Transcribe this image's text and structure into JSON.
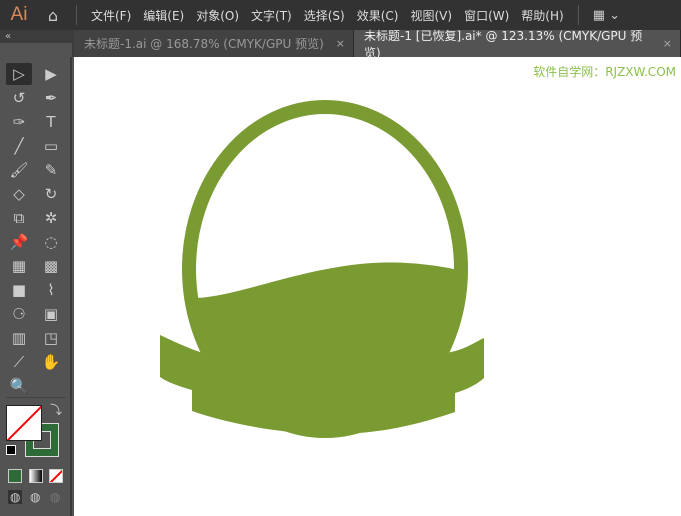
{
  "app": {
    "logo": "Ai",
    "home_icon": "home-icon"
  },
  "menu": [
    "文件(F)",
    "编辑(E)",
    "对象(O)",
    "文字(T)",
    "选择(S)",
    "效果(C)",
    "视图(V)",
    "窗口(W)",
    "帮助(H)"
  ],
  "workspace_icon": "workspace-layout-icon",
  "tabs": [
    {
      "label": "未标题-1.ai @ 168.78% (CMYK/GPU 预览)",
      "close": "×",
      "active": false
    },
    {
      "label": "未标题-1 [已恢复].ai* @ 123.13% (CMYK/GPU 预览)",
      "close": "×",
      "active": true
    }
  ],
  "toolbar_collapse": "«",
  "tools": [
    [
      "▷",
      "▶"
    ],
    [
      "↺",
      "✒"
    ],
    [
      "✑",
      "T"
    ],
    [
      "╱",
      "▭"
    ],
    [
      "🖌",
      "✎"
    ],
    [
      "◇",
      "↻"
    ],
    [
      "⧉",
      "✲"
    ],
    [
      "📌",
      "◌"
    ],
    [
      "▦",
      "▩"
    ],
    [
      "■",
      "⌇"
    ],
    [
      "⚆",
      "▣"
    ],
    [
      "▥",
      "◳"
    ],
    [
      "⟋",
      "✋"
    ],
    [
      "🔍"
    ]
  ],
  "colors": {
    "basket": "#7a9a32",
    "stroke_swatch": "#2f6b38",
    "watermark": "#8cc04a"
  },
  "watermark": "软件自学网：RJZXW.COM"
}
